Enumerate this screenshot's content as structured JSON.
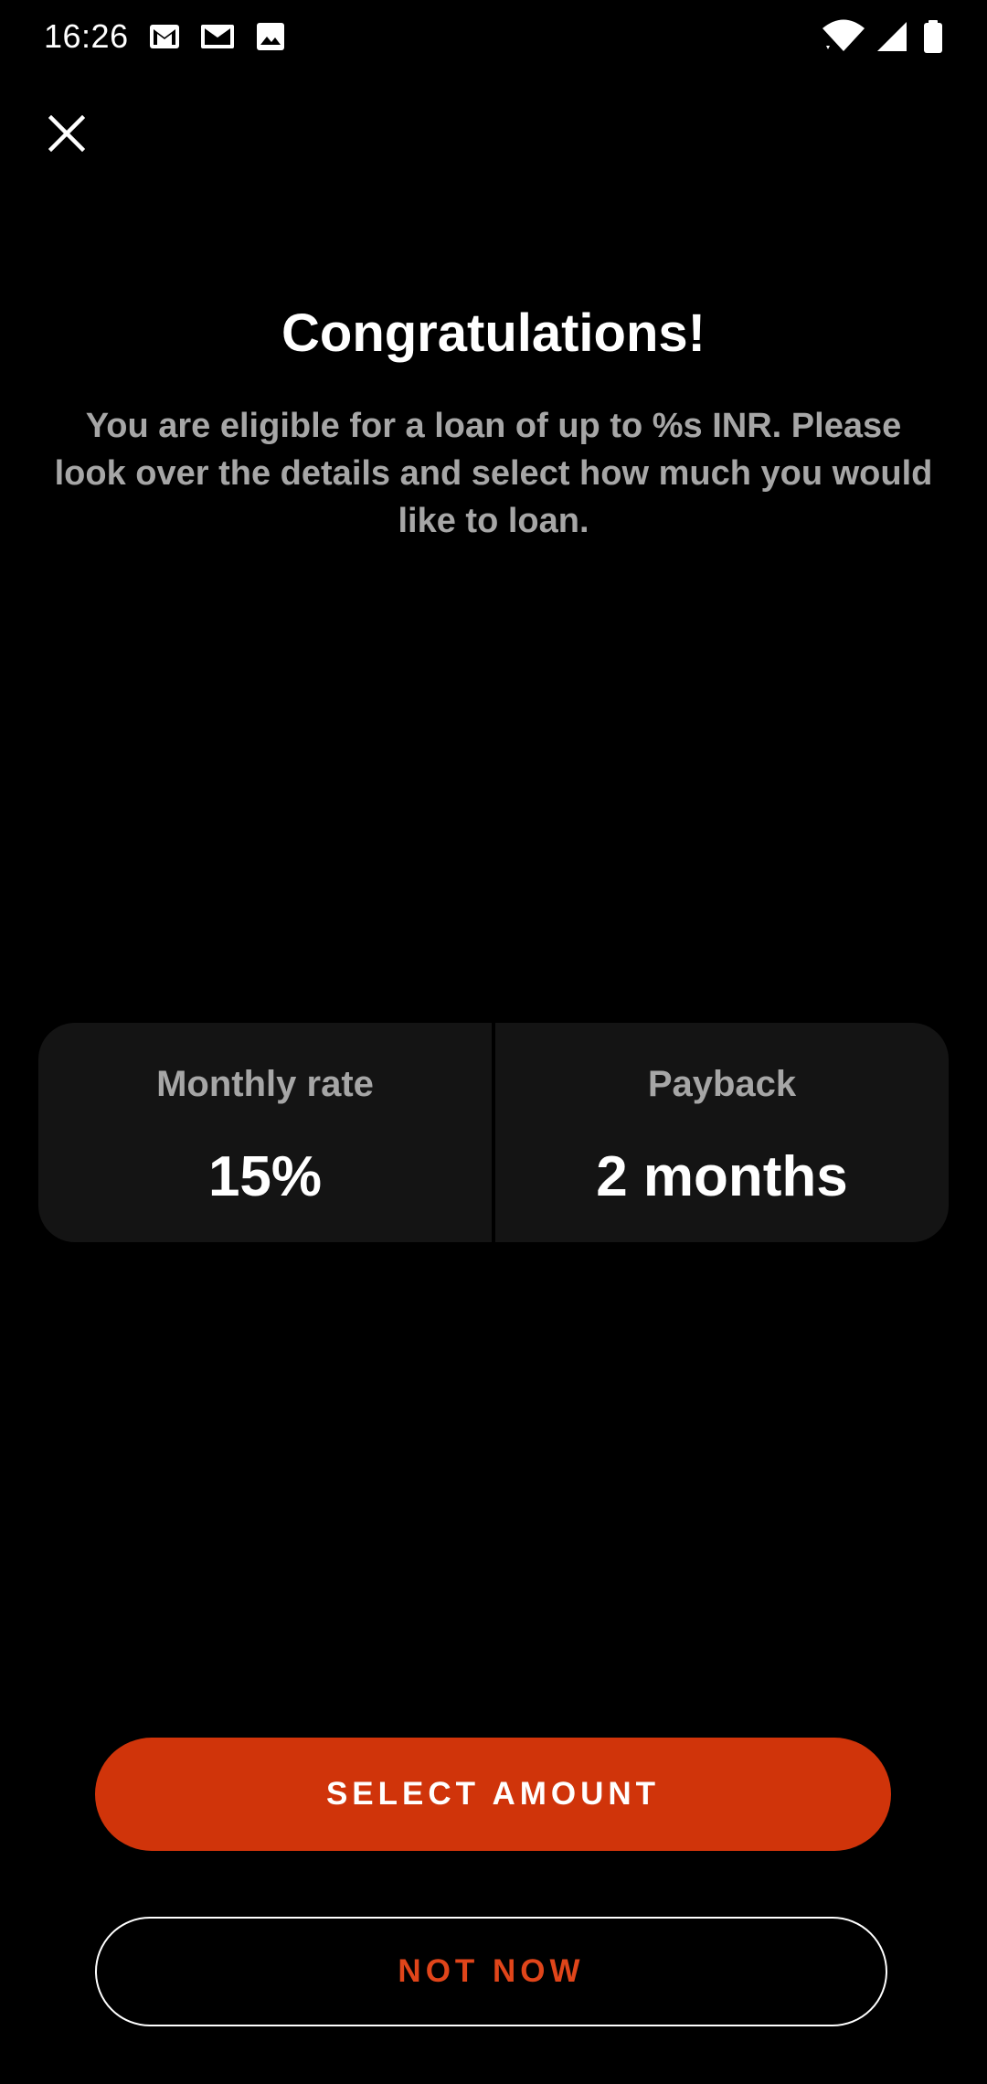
{
  "status_bar": {
    "time": "16:26",
    "notification_icons": [
      "gmail-icon",
      "email-icon",
      "image-icon"
    ],
    "system_icons": [
      "wifi-icon",
      "cellular-signal-icon",
      "battery-icon"
    ]
  },
  "header": {
    "close_icon": "close-icon",
    "title": "Congratulations!",
    "subtitle": "You are eligible for a loan of up to %s INR. Please look over the details and select how much you would like to loan."
  },
  "loan_details": {
    "monthly_rate": {
      "label": "Monthly rate",
      "value": "15%"
    },
    "payback": {
      "label": "Payback",
      "value": "2 months"
    }
  },
  "actions": {
    "primary_label": "SELECT AMOUNT",
    "secondary_label": "NOT NOW"
  },
  "colors": {
    "background": "#000000",
    "accent": "#d0340a",
    "card": "#141414",
    "muted_text": "#a6a6a6"
  }
}
